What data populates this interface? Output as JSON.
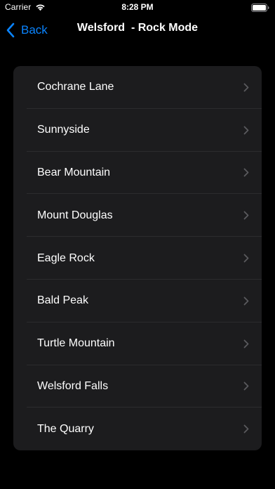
{
  "status_bar": {
    "carrier": "Carrier",
    "time": "8:28 PM"
  },
  "nav": {
    "back_label": "Back",
    "title": "Welsford  - Rock Mode"
  },
  "list": {
    "items": [
      {
        "label": "Cochrane Lane"
      },
      {
        "label": "Sunnyside"
      },
      {
        "label": "Bear Mountain"
      },
      {
        "label": "Mount Douglas"
      },
      {
        "label": "Eagle Rock"
      },
      {
        "label": "Bald Peak"
      },
      {
        "label": "Turtle Mountain"
      },
      {
        "label": "Welsford Falls"
      },
      {
        "label": "The Quarry"
      }
    ]
  },
  "colors": {
    "background": "#000000",
    "card": "#1c1c1e",
    "accent": "#0a84ff",
    "chevron": "#5a5a5e",
    "divider": "#2c2c2e"
  },
  "icons": {
    "wifi": "wifi-icon",
    "battery": "battery-icon",
    "back": "chevron-left-icon",
    "row": "chevron-right-icon"
  }
}
